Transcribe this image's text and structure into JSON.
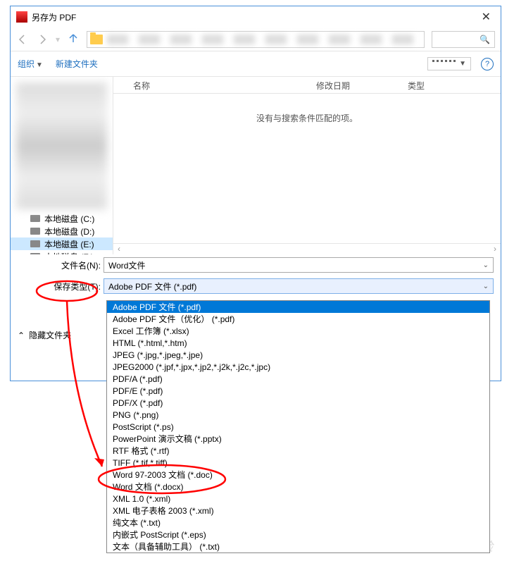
{
  "window": {
    "title": "另存为 PDF"
  },
  "toolbar": {
    "organize": "组织",
    "newFolder": "新建文件夹"
  },
  "columns": {
    "name": "名称",
    "modified": "修改日期",
    "type": "类型"
  },
  "emptyMessage": "没有与搜索条件匹配的项。",
  "drives": [
    {
      "label": "本地磁盘 (C:)"
    },
    {
      "label": "本地磁盘 (D:)"
    },
    {
      "label": "本地磁盘 (E:)"
    },
    {
      "label": "本地磁盘 (F:)"
    }
  ],
  "fields": {
    "filenameLabel": "文件名(N):",
    "filenameValue": "Word文件",
    "savetypeLabel": "保存类型(T):",
    "savetypeValue": "Adobe PDF 文件 (*.pdf)"
  },
  "hideFolders": "隐藏文件夹",
  "fileTypes": [
    "Adobe PDF 文件 (*.pdf)",
    "Adobe PDF 文件（优化） (*.pdf)",
    "Excel 工作簿 (*.xlsx)",
    "HTML (*.html,*.htm)",
    "JPEG (*.jpg,*.jpeg,*.jpe)",
    "JPEG2000 (*.jpf,*.jpx,*.jp2,*.j2k,*.j2c,*.jpc)",
    "PDF/A (*.pdf)",
    "PDF/E (*.pdf)",
    "PDF/X (*.pdf)",
    "PNG (*.png)",
    "PostScript (*.ps)",
    "PowerPoint 演示文稿 (*.pptx)",
    "RTF 格式 (*.rtf)",
    "TIFF (*.tif,*.tiff)",
    "Word 97-2003 文档 (*.doc)",
    "Word 文档 (*.docx)",
    "XML 1.0 (*.xml)",
    "XML 电子表格 2003 (*.xml)",
    "纯文本 (*.txt)",
    "内嵌式 PostScript (*.eps)",
    "文本（具备辅助工具） (*.txt)"
  ],
  "watermark": "经验"
}
